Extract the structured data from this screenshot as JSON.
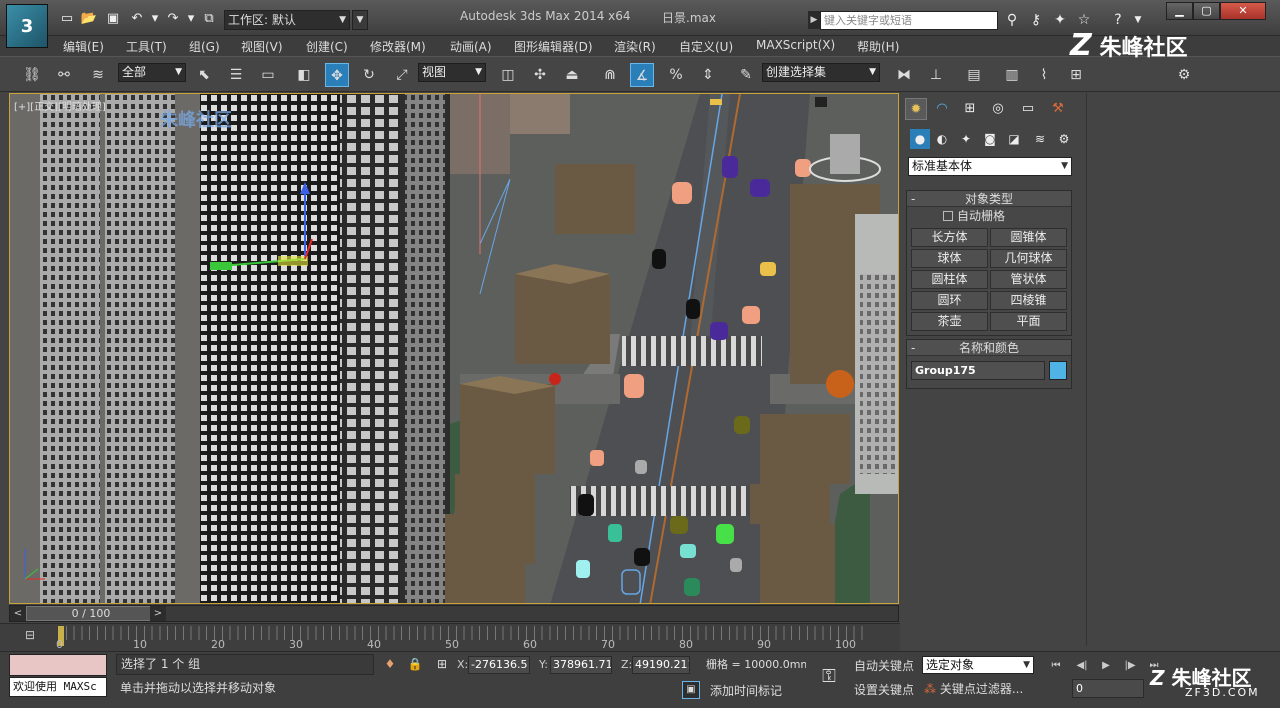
{
  "titlebar": {
    "app_logo": "3",
    "workspace_value": "工作区: 默认",
    "app_title": "Autodesk 3ds Max  2014 x64",
    "doc_title": "日景.max",
    "search_placeholder": "键入关键字或短语",
    "win_min": "▁",
    "win_max": "▢",
    "win_close": "✕"
  },
  "menu": {
    "items": [
      "编辑(E)",
      "工具(T)",
      "组(G)",
      "视图(V)",
      "创建(C)",
      "修改器(M)",
      "动画(A)",
      "图形编辑器(D)",
      "渲染(R)",
      "自定义(U)",
      "MAXScript(X)",
      "帮助(H)"
    ]
  },
  "toolbar": {
    "selection_filter": "全部",
    "ref_coord": "视图",
    "named_selection": "创建选择集"
  },
  "brand": {
    "name": "朱峰社区",
    "site": "ZF3D.COM",
    "mark": "Z"
  },
  "viewport": {
    "label": "[+][正交][明暗处理]",
    "watermark": "朱峰社区"
  },
  "command_panel": {
    "primitive_type": "标准基本体",
    "object_type_title": "对象类型",
    "auto_grid": "自动栅格",
    "objects": [
      "长方体",
      "圆锥体",
      "球体",
      "几何球体",
      "圆柱体",
      "管状体",
      "圆环",
      "四棱锥",
      "茶壶",
      "平面"
    ],
    "name_color_title": "名称和颜色",
    "object_name": "Group175",
    "object_color": "#4fb3e6"
  },
  "timeline": {
    "frame_display": "0 / 100",
    "ticks": [
      "0",
      "10",
      "20",
      "30",
      "40",
      "50",
      "60",
      "70",
      "80",
      "90",
      "100"
    ]
  },
  "status": {
    "maxscript_label": "欢迎使用 MAXSc",
    "selection_status": "选择了 1 个 组",
    "prompt": "单击并拖动以选择并移动对象",
    "x_label": "X:",
    "x_value": "-276136.5",
    "y_label": "Y:",
    "y_value": "378961.71",
    "z_label": "Z:",
    "z_value": "49190.211",
    "grid": "栅格 = 10000.0mm",
    "add_time_tag": "添加时间标记",
    "auto_key": "自动关键点",
    "set_key": "设置关键点",
    "key_mode": "选定对象",
    "key_filters": "关键点过滤器...",
    "current_frame": "0"
  }
}
